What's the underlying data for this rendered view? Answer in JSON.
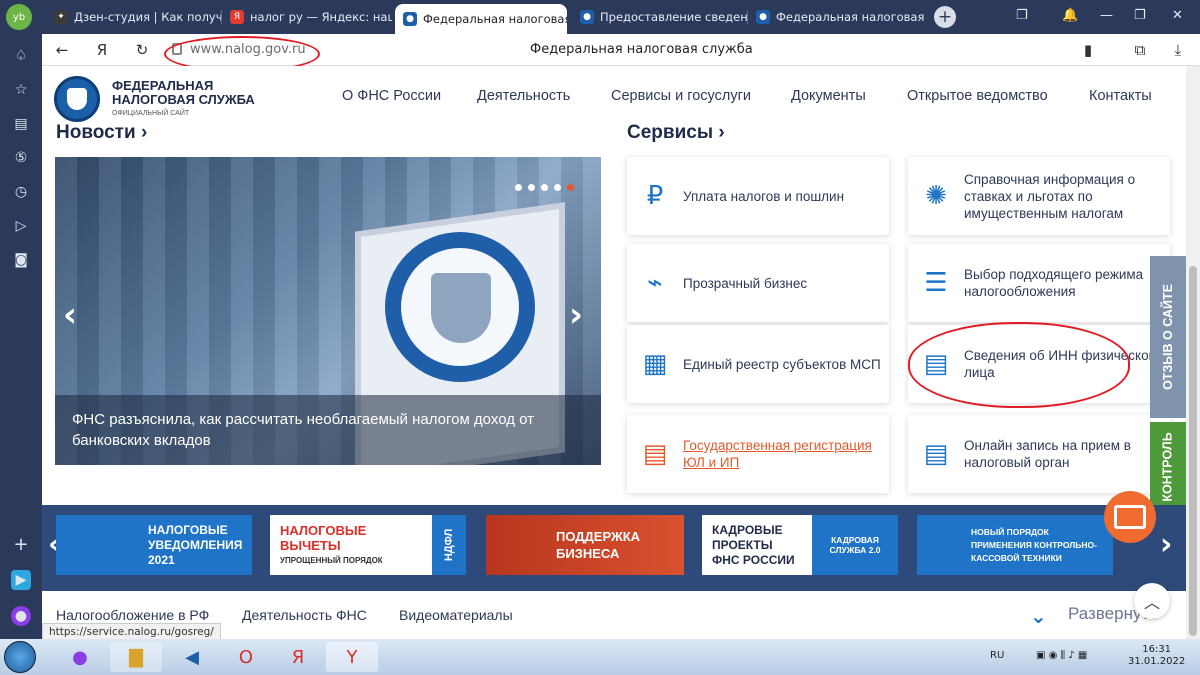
{
  "browser": {
    "tabs": [
      {
        "label": "Дзен-студия | Как получить",
        "fav_color": "#3a3a3a"
      },
      {
        "label": "налог ру — Яндекс: нашлось",
        "fav_color": "#e23b2f"
      },
      {
        "label": "Федеральная налоговая служба",
        "fav_color": "#1f5ea8"
      },
      {
        "label": "Предоставление сведений",
        "fav_color": "#1f5ea8"
      },
      {
        "label": "Федеральная налоговая служба",
        "fav_color": "#1f5ea8"
      }
    ],
    "new_tab": "+",
    "url": "www.nalog.gov.ru",
    "page_title": "Федеральная налоговая служба",
    "status_url": "https://service.nalog.ru/gosreg/"
  },
  "site": {
    "logo_line1": "ФЕДЕРАЛЬНАЯ",
    "logo_line2": "НАЛОГОВАЯ СЛУЖБА",
    "logo_sub": "ОФИЦИАЛЬНЫЙ САЙТ",
    "nav": [
      "О ФНС России",
      "Деятельность",
      "Сервисы и госуслуги",
      "Документы",
      "Открытое ведомство",
      "Контакты"
    ],
    "news_title": "Новости ›",
    "services_title": "Сервисы ›",
    "news_caption": "ФНС разъяснила, как рассчитать необлагаемый налогом доход от банковских вкладов",
    "services": [
      {
        "label": "Уплата налогов и пошлин",
        "icon": "ruble-phone-icon"
      },
      {
        "label": "Справочная информация о ставках и льготах по имущественным налогам",
        "icon": "network-icon"
      },
      {
        "label": "Прозрачный бизнес",
        "icon": "lamp-icon"
      },
      {
        "label": "Выбор подходящего режима налогообложения",
        "icon": "sliders-icon"
      },
      {
        "label": "Единый реестр субъектов МСП",
        "icon": "msp-icon"
      },
      {
        "label": "Сведения об ИНН физического лица",
        "icon": "inn-document-icon"
      },
      {
        "label": "Государственная регистрация ЮЛ и ИП",
        "icon": "ul-ip-document-icon"
      },
      {
        "label": "Онлайн запись на прием в налоговый орган",
        "icon": "m02-document-icon"
      }
    ],
    "side_tabs": [
      "ОТЗЫВ О САЙТЕ",
      "КОНТРОЛЬ"
    ],
    "banners": [
      {
        "line1": "НАЛОГОВЫЕ",
        "line2": "УВЕДОМЛЕНИЯ",
        "line3": "2021"
      },
      {
        "line1": "НАЛОГОВЫЕ",
        "line2": "ВЫЧЕТЫ",
        "line3": "УПРОЩЕННЫЙ ПОРЯДОК",
        "tag": "НДФЛ"
      },
      {
        "line1": "ПОДДЕРЖКА",
        "line2": "БИЗНЕСА"
      },
      {
        "line1": "КАДРОВЫЕ",
        "line2": "ПРОЕКТЫ",
        "line3": "ФНС РОССИИ",
        "tag": "КАДРОВАЯ СЛУЖБА 2.0"
      },
      {
        "line1": "НОВЫЙ ПОРЯДОК",
        "line2": "ПРИМЕНЕНИЯ КОНТРОЛЬНО-",
        "line3": "КАССОВОЙ ТЕХНИКИ"
      }
    ],
    "bottom_links": [
      "Налогообложение в РФ",
      "Деятельность ФНС",
      "Видеоматериалы"
    ],
    "expand_label": "Развернуть"
  },
  "taskbar": {
    "lang": "RU",
    "time": "16:31",
    "date": "31.01.2022"
  },
  "colors": {
    "accent": "#1f74c7",
    "orange": "#e45a2d",
    "dark": "#2b3a5a"
  }
}
